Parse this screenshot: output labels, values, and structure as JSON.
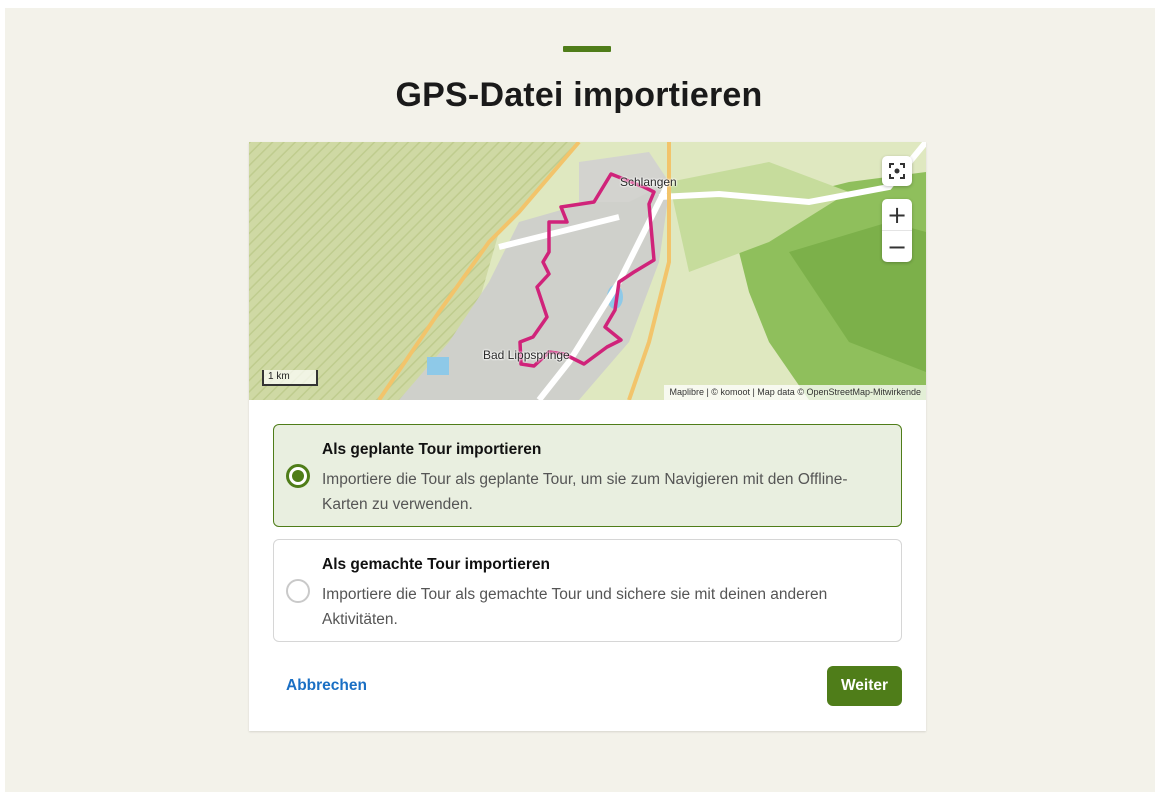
{
  "page": {
    "title": "GPS-Datei importieren",
    "accent_color": "#4f7d19"
  },
  "map": {
    "labels": {
      "town_1": "Schlangen",
      "town_2": "Bad Lippspringe"
    },
    "scale_label": "1 km",
    "attribution": "Maplibre | © komoot | Map data © OpenStreetMap-Mitwirkende",
    "controls": {
      "locate_icon": "focus-icon",
      "zoom_in": "+",
      "zoom_out": "−"
    },
    "route_color": "#d0237a"
  },
  "options": [
    {
      "title": "Als geplante Tour importieren",
      "description": "Importiere die Tour als geplante Tour, um sie zum Navigieren mit den Offline-Karten zu verwenden.",
      "selected": true
    },
    {
      "title": "Als gemachte Tour importieren",
      "description": "Importiere die Tour als gemachte Tour und sichere sie mit deinen anderen Aktivitäten.",
      "selected": false
    }
  ],
  "actions": {
    "cancel_label": "Abbrechen",
    "next_label": "Weiter",
    "link_color": "#1a6fc4"
  }
}
